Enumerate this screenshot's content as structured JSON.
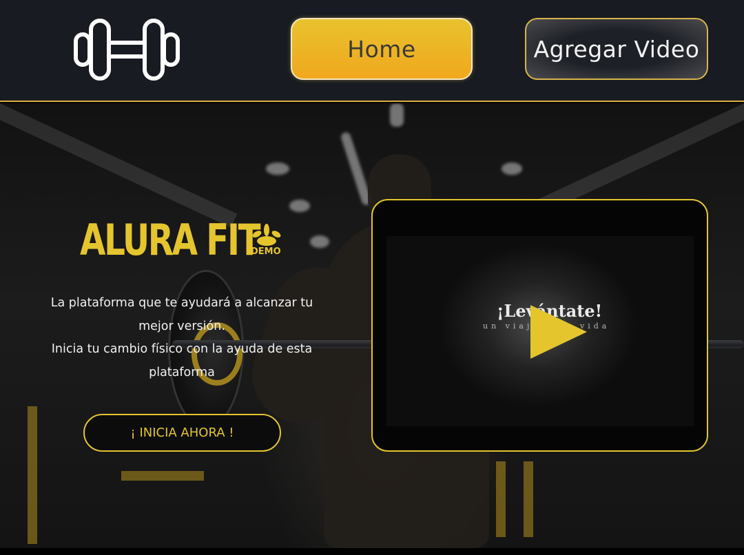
{
  "header": {
    "logo_icon": "dumbbell-icon",
    "nav": [
      {
        "label": "Home"
      },
      {
        "label": "Agregar Video"
      }
    ]
  },
  "hero": {
    "brand_title": "ALURA FIT",
    "brand_badge": "DEMO",
    "tagline_line1": "La plataforma que te ayudará a alcanzar tu mejor versión.",
    "tagline_line2": "Inicia tu cambio físico con la ayuda de esta plataforma",
    "cta_label": "¡ INICIA AHORA !"
  },
  "video": {
    "title": "¡Levántate!",
    "subtitle": "un viaje a la vida",
    "play_icon": "play-icon"
  },
  "colors": {
    "accent": "#e4c52e",
    "header_bg": "#181b22",
    "button_orange": "#f0a81d"
  }
}
